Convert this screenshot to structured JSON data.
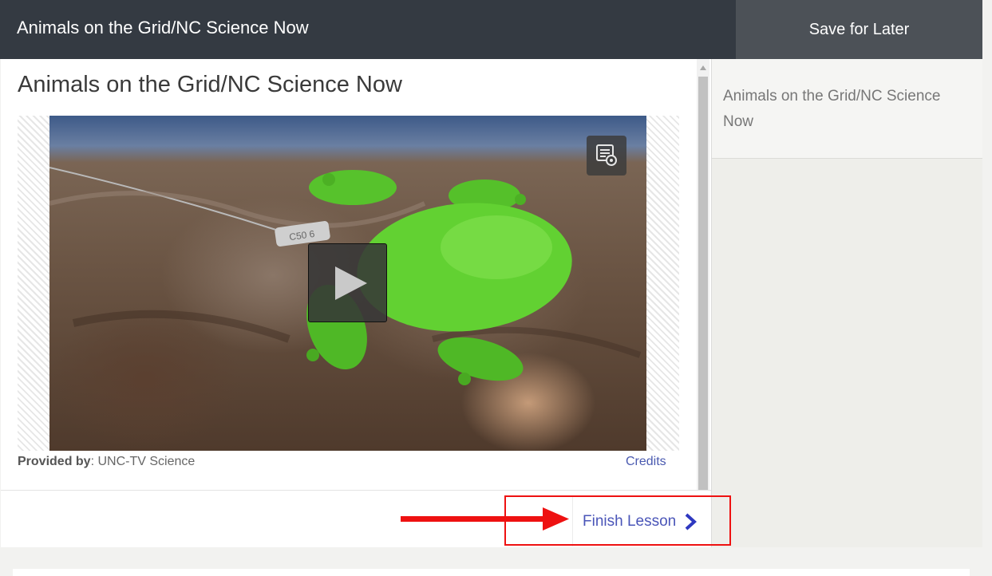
{
  "header": {
    "title": "Animals on the Grid/NC Science Now",
    "save_label": "Save for Later"
  },
  "main": {
    "title": "Animals on the Grid/NC Science Now",
    "video": {
      "tag_text": "C50 6"
    },
    "provided_label": "Provided by",
    "provided_value": ": UNC-TV Science",
    "credits_label": "Credits",
    "finish_label": "Finish Lesson"
  },
  "sidebar": {
    "items": [
      {
        "label": "Animals on the Grid/NC Science Now"
      }
    ]
  },
  "colors": {
    "header_bg": "#343a42",
    "save_bg": "#4c5157",
    "link": "#4a55b8",
    "annotation": "#ee1111"
  },
  "icons": [
    "transcript-icon",
    "play-icon",
    "chevron-right-icon",
    "scroll-up-icon"
  ]
}
